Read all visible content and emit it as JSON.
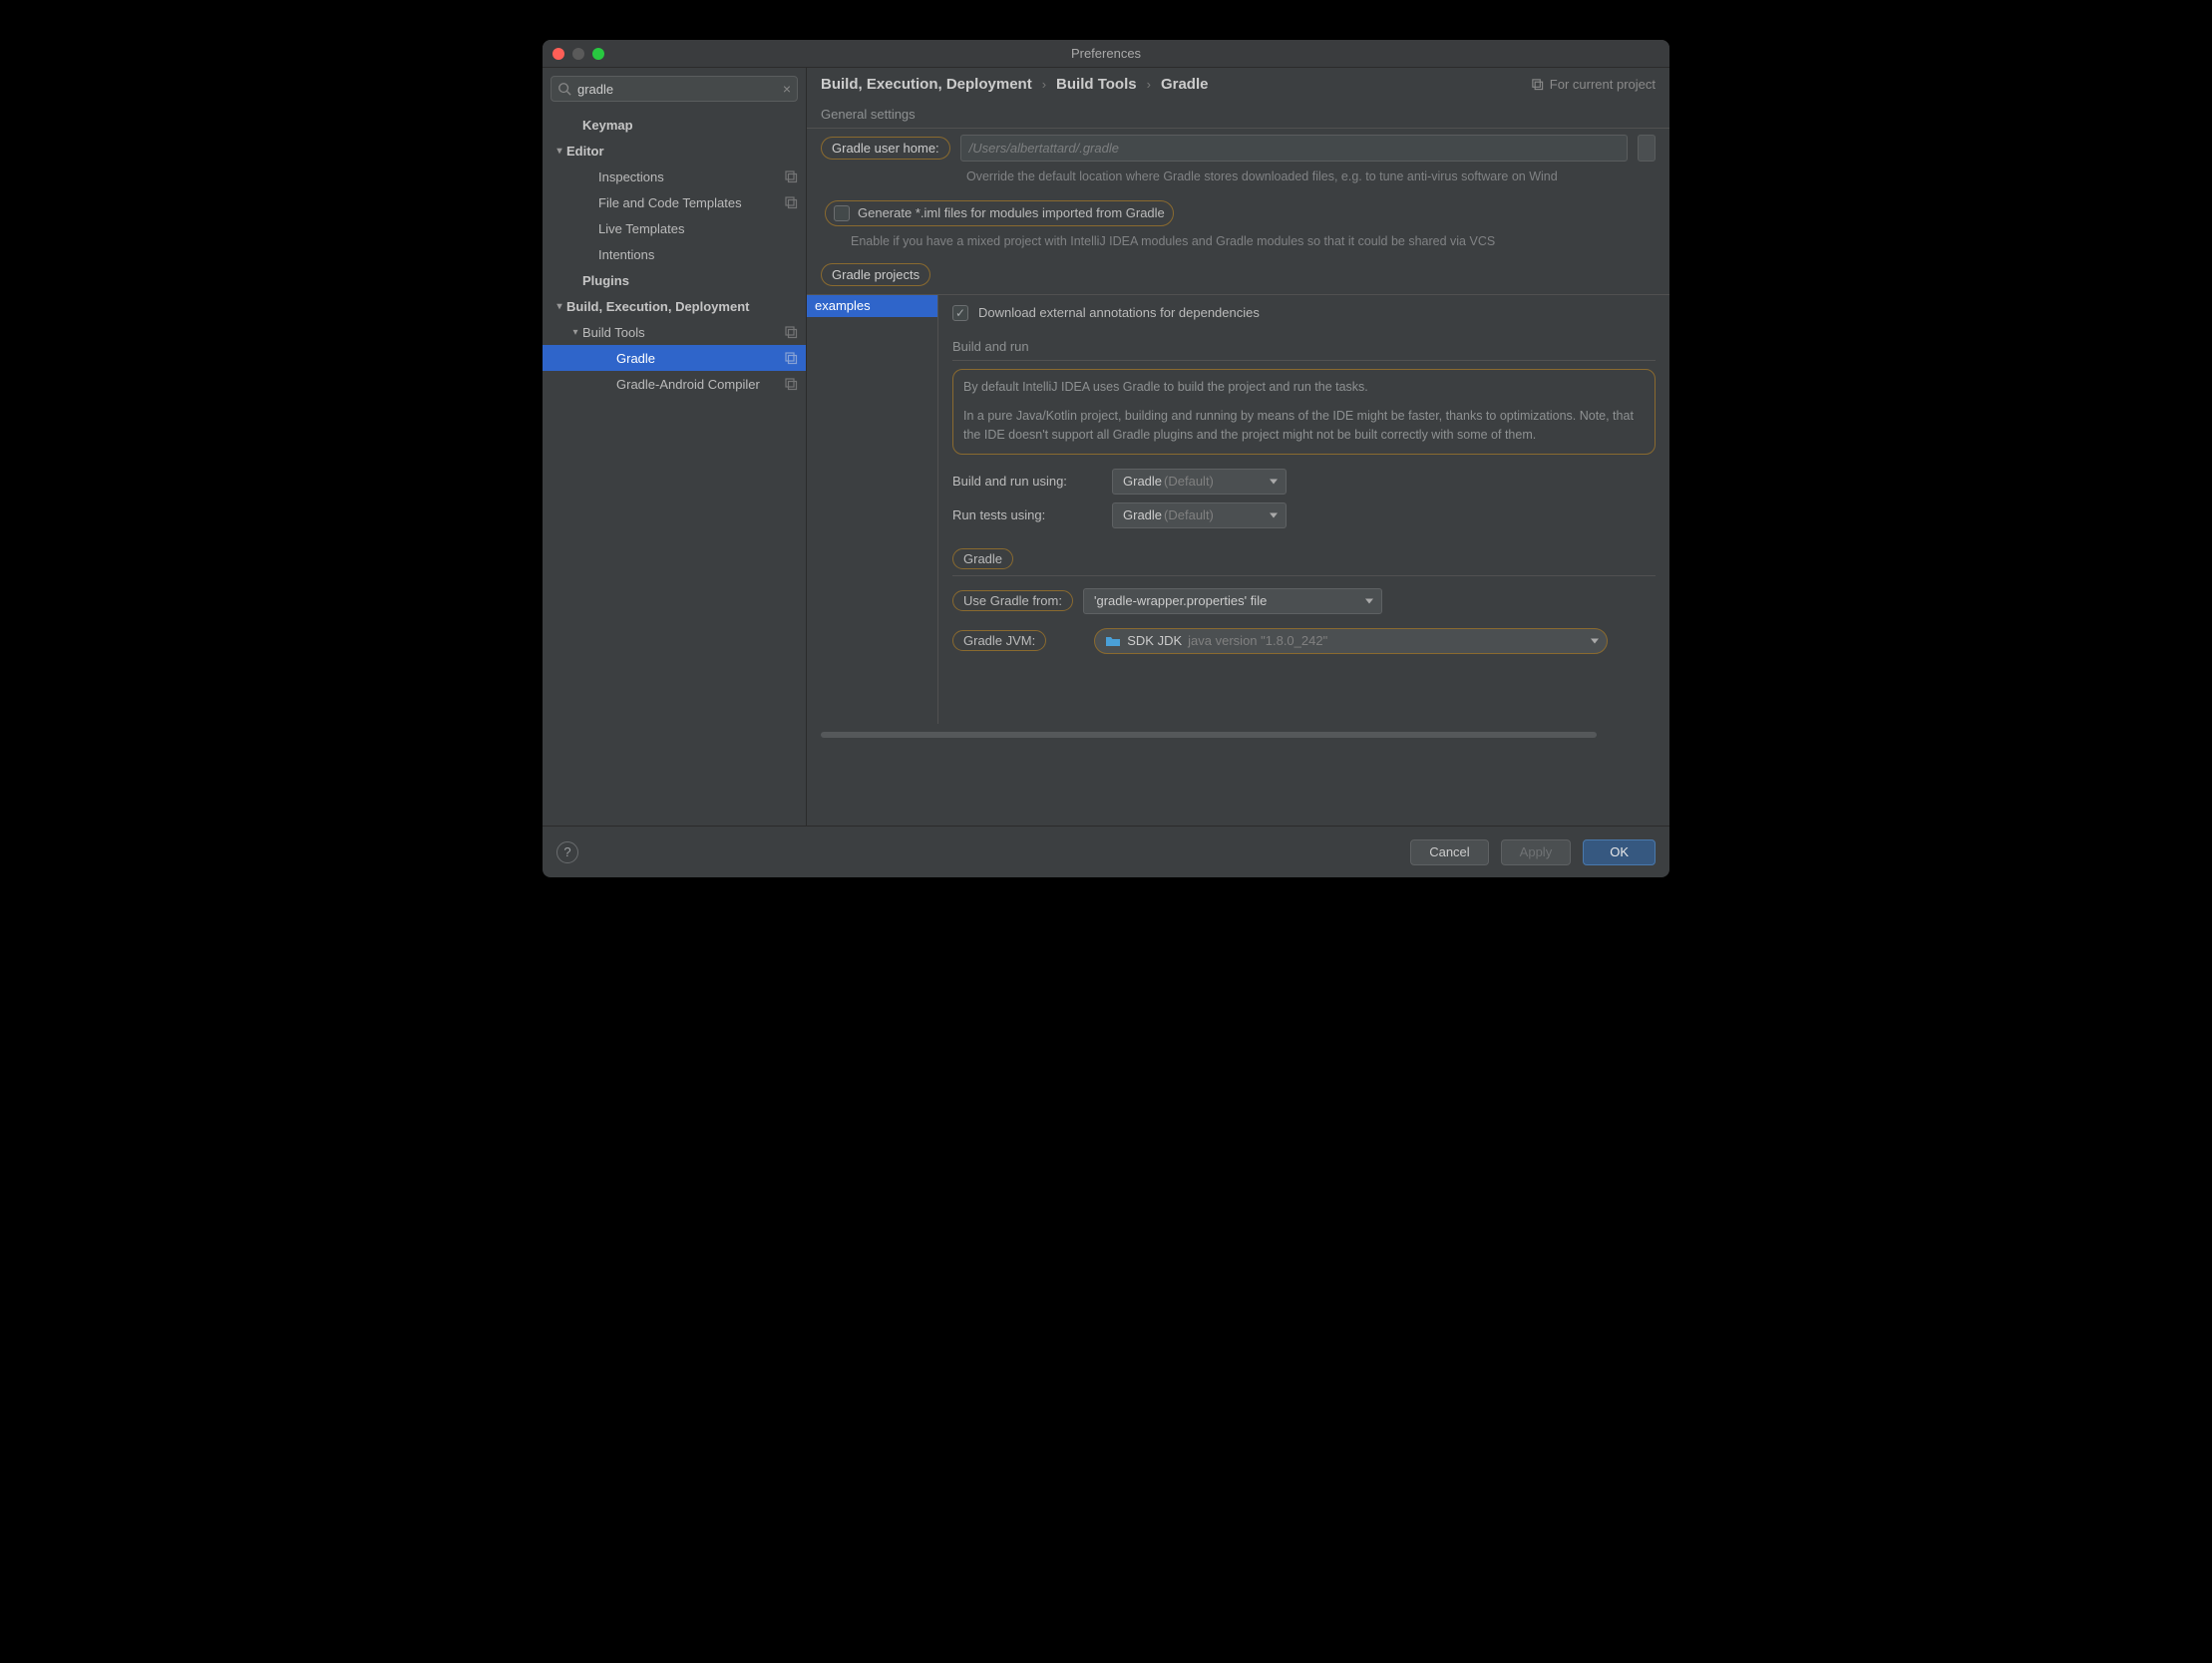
{
  "window": {
    "title": "Preferences"
  },
  "search": {
    "value": "gradle"
  },
  "sidebar": {
    "items": [
      {
        "label": "Keymap",
        "depth": 1,
        "bold": true
      },
      {
        "label": "Editor",
        "depth": 1,
        "bold": true,
        "chev": "▾"
      },
      {
        "label": "Inspections",
        "depth": 2,
        "badge": true
      },
      {
        "label": "File and Code Templates",
        "depth": 2,
        "badge": true
      },
      {
        "label": "Live Templates",
        "depth": 2
      },
      {
        "label": "Intentions",
        "depth": 2
      },
      {
        "label": "Plugins",
        "depth": 1,
        "bold": true
      },
      {
        "label": "Build, Execution, Deployment",
        "depth": 1,
        "bold": true,
        "chev": "▾"
      },
      {
        "label": "Build Tools",
        "depth": 2,
        "chev": "▾",
        "badge": true
      },
      {
        "label": "Gradle",
        "depth": 3,
        "badge": true,
        "selected": true
      },
      {
        "label": "Gradle-Android Compiler",
        "depth": 3,
        "badge": true
      }
    ]
  },
  "breadcrumb": {
    "a": "Build, Execution, Deployment",
    "b": "Build Tools",
    "c": "Gradle",
    "scope": "For current project"
  },
  "general": {
    "title": "General settings",
    "user_home_label": "Gradle user home:",
    "user_home_placeholder": "/Users/albertattard/.gradle",
    "user_home_hint": "Override the default location where Gradle stores downloaded files, e.g. to tune anti-virus software on Wind",
    "gen_iml_label": "Generate *.iml files for modules imported from Gradle",
    "gen_iml_hint": "Enable if you have a mixed project with IntelliJ IDEA modules and Gradle modules so that it could be shared via VCS"
  },
  "projects": {
    "title": "Gradle projects",
    "list": [
      "examples"
    ],
    "download_annotations": "Download external annotations for dependencies",
    "build_run_head": "Build and run",
    "build_run_info_1": "By default IntelliJ IDEA uses Gradle to build the project and run the tasks.",
    "build_run_info_2": "In a pure Java/Kotlin project, building and running by means of the IDE might be faster, thanks to optimizations. Note, that the IDE doesn't support all Gradle plugins and the project might not be built correctly with some of them.",
    "build_using_label": "Build and run using:",
    "run_tests_label": "Run tests using:",
    "dd_gradle": "Gradle",
    "dd_default": "(Default)",
    "gradle_head": "Gradle",
    "use_from_label": "Use Gradle from:",
    "use_from_value": "'gradle-wrapper.properties' file",
    "jvm_label": "Gradle JVM:",
    "jvm_value_a": "SDK JDK",
    "jvm_value_b": "java version \"1.8.0_242\""
  },
  "footer": {
    "cancel": "Cancel",
    "apply": "Apply",
    "ok": "OK"
  }
}
